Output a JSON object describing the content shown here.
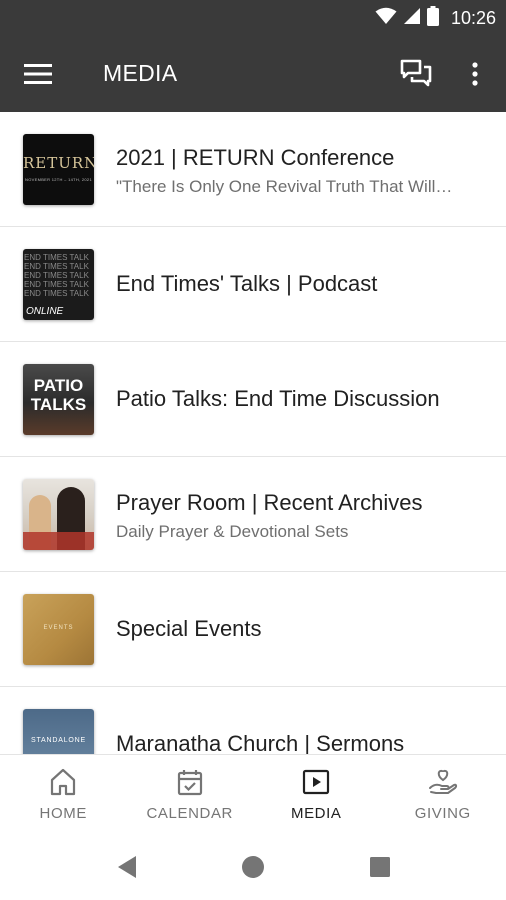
{
  "status_bar": {
    "time": "10:26"
  },
  "app_bar": {
    "title": "MEDIA"
  },
  "media_items": [
    {
      "title": "2021 | RETURN Conference",
      "subtitle": "\"There Is Only One Revival Truth That Will…",
      "thumb_text": "RETURN",
      "thumb_sub": "NOVEMBER 12TH – 14TH, 2021"
    },
    {
      "title": "End Times' Talks | Podcast",
      "subtitle": "",
      "thumb_text": "END TIMES TALK",
      "thumb_sub": "ONLINE"
    },
    {
      "title": "Patio Talks: End Time Discussion",
      "subtitle": "",
      "thumb_text": "PATIO",
      "thumb_sub": "TALKS"
    },
    {
      "title": "Prayer Room | Recent Archives",
      "subtitle": "Daily Prayer & Devotional Sets",
      "thumb_text": "",
      "thumb_sub": ""
    },
    {
      "title": "Special Events",
      "subtitle": "",
      "thumb_text": "EVENTS",
      "thumb_sub": ""
    },
    {
      "title": "Maranatha Church | Sermons",
      "subtitle": "",
      "thumb_text": "STANDALONE",
      "thumb_sub": ""
    }
  ],
  "bottom_nav": {
    "tabs": [
      {
        "label": "HOME",
        "icon": "home-icon"
      },
      {
        "label": "CALENDAR",
        "icon": "calendar-icon"
      },
      {
        "label": "MEDIA",
        "icon": "media-play-icon",
        "active": true
      },
      {
        "label": "GIVING",
        "icon": "giving-hand-heart-icon"
      }
    ]
  },
  "colors": {
    "app_bar": "#3a3a3a",
    "text": "#212121",
    "subtext": "#6f6f6f",
    "divider": "#e4e4e4"
  }
}
